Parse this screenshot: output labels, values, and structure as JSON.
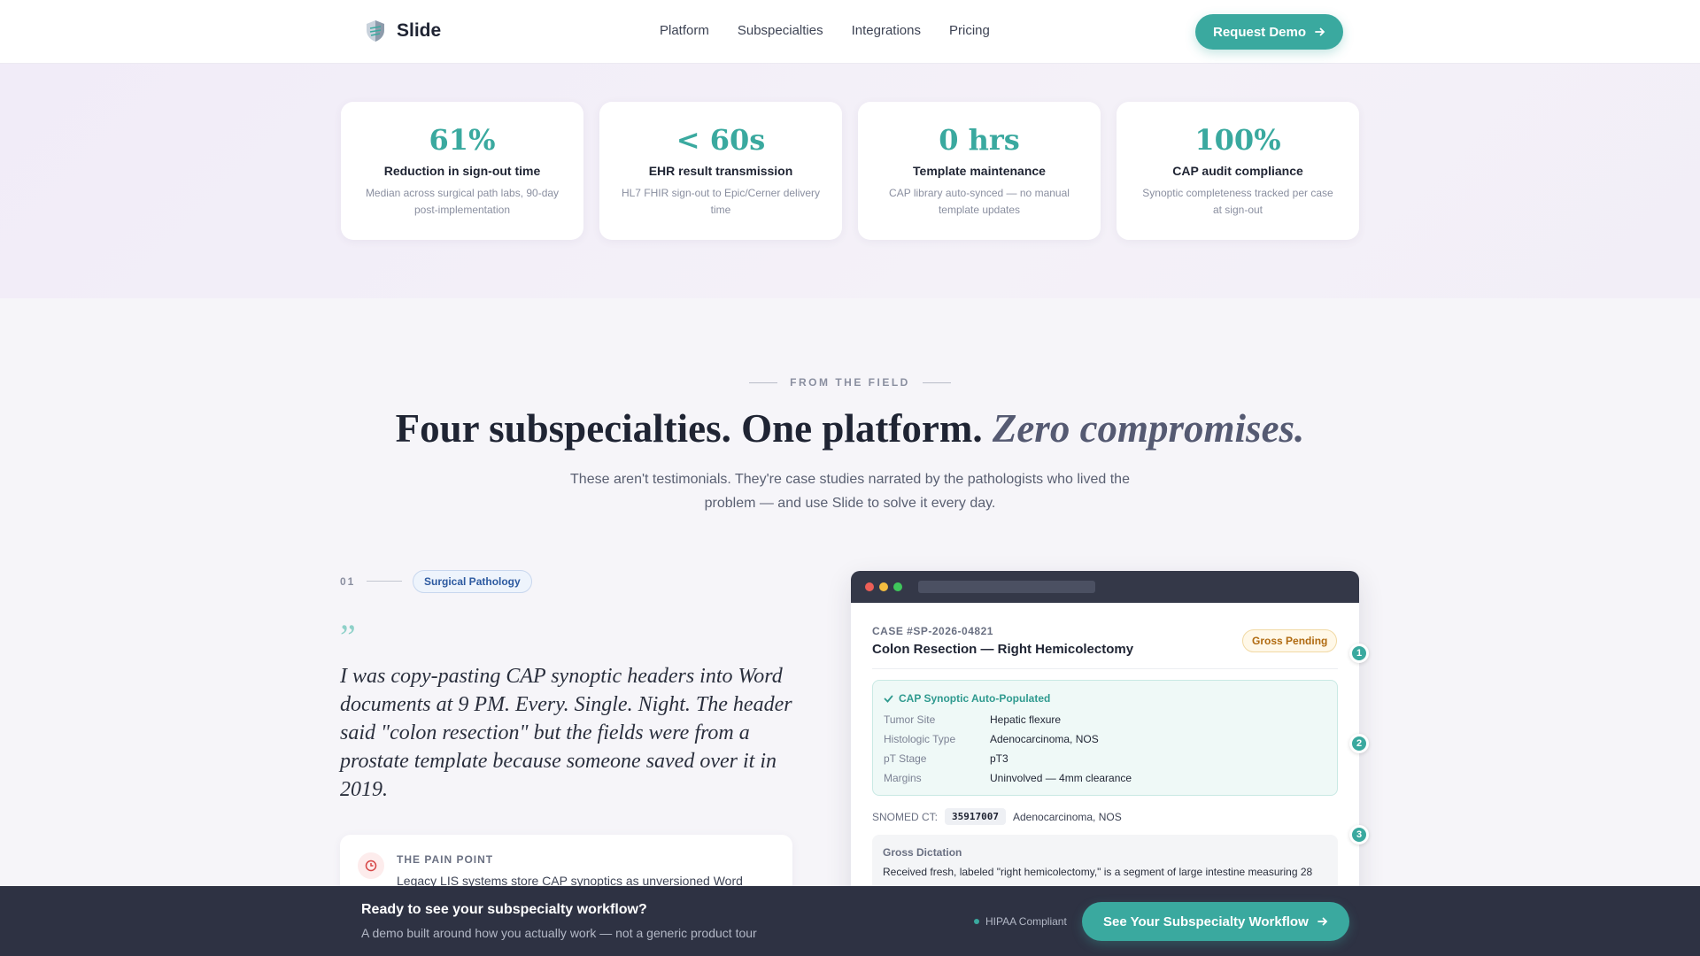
{
  "nav": {
    "brand": "Slide",
    "links": [
      "Platform",
      "Subspecialties",
      "Integrations",
      "Pricing"
    ],
    "cta": "Request Demo"
  },
  "stats": [
    {
      "value": "61%",
      "label": "Reduction in sign-out time",
      "desc": "Median across surgical path labs, 90-day post-implementation"
    },
    {
      "value": "< 60s",
      "label": "EHR result transmission",
      "desc": "HL7 FHIR sign-out to Epic/Cerner delivery time"
    },
    {
      "value": "0 hrs",
      "label": "Template maintenance",
      "desc": "CAP library auto-synced — no manual template updates"
    },
    {
      "value": "100%",
      "label": "CAP audit compliance",
      "desc": "Synoptic completeness tracked per case at sign-out"
    }
  ],
  "section": {
    "eyebrow": "FROM THE FIELD",
    "headline_plain": "Four subspecialties. One platform.",
    "headline_italic": "Zero compromises.",
    "subhead": "These aren't testimonials. They're case studies narrated by the pathologists who lived the problem — and use Slide to solve it every day."
  },
  "story": {
    "number": "01",
    "tag": "Surgical Pathology",
    "quote_mark": "”",
    "quote": "I was copy-pasting CAP synoptic headers into Word documents at 9 PM. Every. Single. Night. The header said \"colon resection\" but the fields were from a prostate template because someone saved over it in 2019.",
    "pain_title": "THE PAIN POINT",
    "pain_text": "Legacy LIS systems store CAP synoptics as unversioned Word"
  },
  "app": {
    "case_id": "CASE #SP-2026-04821",
    "case_title": "Colon Resection — Right Hemicolectomy",
    "status": "Gross Pending",
    "cap_title": "CAP Synoptic Auto-Populated",
    "cap_fields": [
      {
        "key": "Tumor Site",
        "value": "Hepatic flexure"
      },
      {
        "key": "Histologic Type",
        "value": "Adenocarcinoma, NOS"
      },
      {
        "key": "pT Stage",
        "value": "pT3"
      },
      {
        "key": "Margins",
        "value": "Uninvolved — 4mm clearance"
      }
    ],
    "snomed_label": "SNOMED CT:",
    "snomed_code": "35917007",
    "snomed_desc": "Adenocarcinoma, NOS",
    "dictation_title": "Gross Dictation",
    "dictation_text": "Received fresh, labeled \"right hemicolectomy,\" is a segment of large intestine measuring 28",
    "steps": [
      "1",
      "2",
      "3"
    ]
  },
  "bottom_bar": {
    "title": "Ready to see your subspecialty workflow?",
    "subtitle": "A demo built around how you actually work — not a generic product tour",
    "hipaa": "HIPAA Compliant",
    "cta": "See Your Subspecialty Workflow"
  },
  "colors": {
    "accent": "#3aa99f",
    "dark": "#2e3243",
    "tag_blue": "#2d5aa0",
    "status_amber": "#b06a10"
  }
}
